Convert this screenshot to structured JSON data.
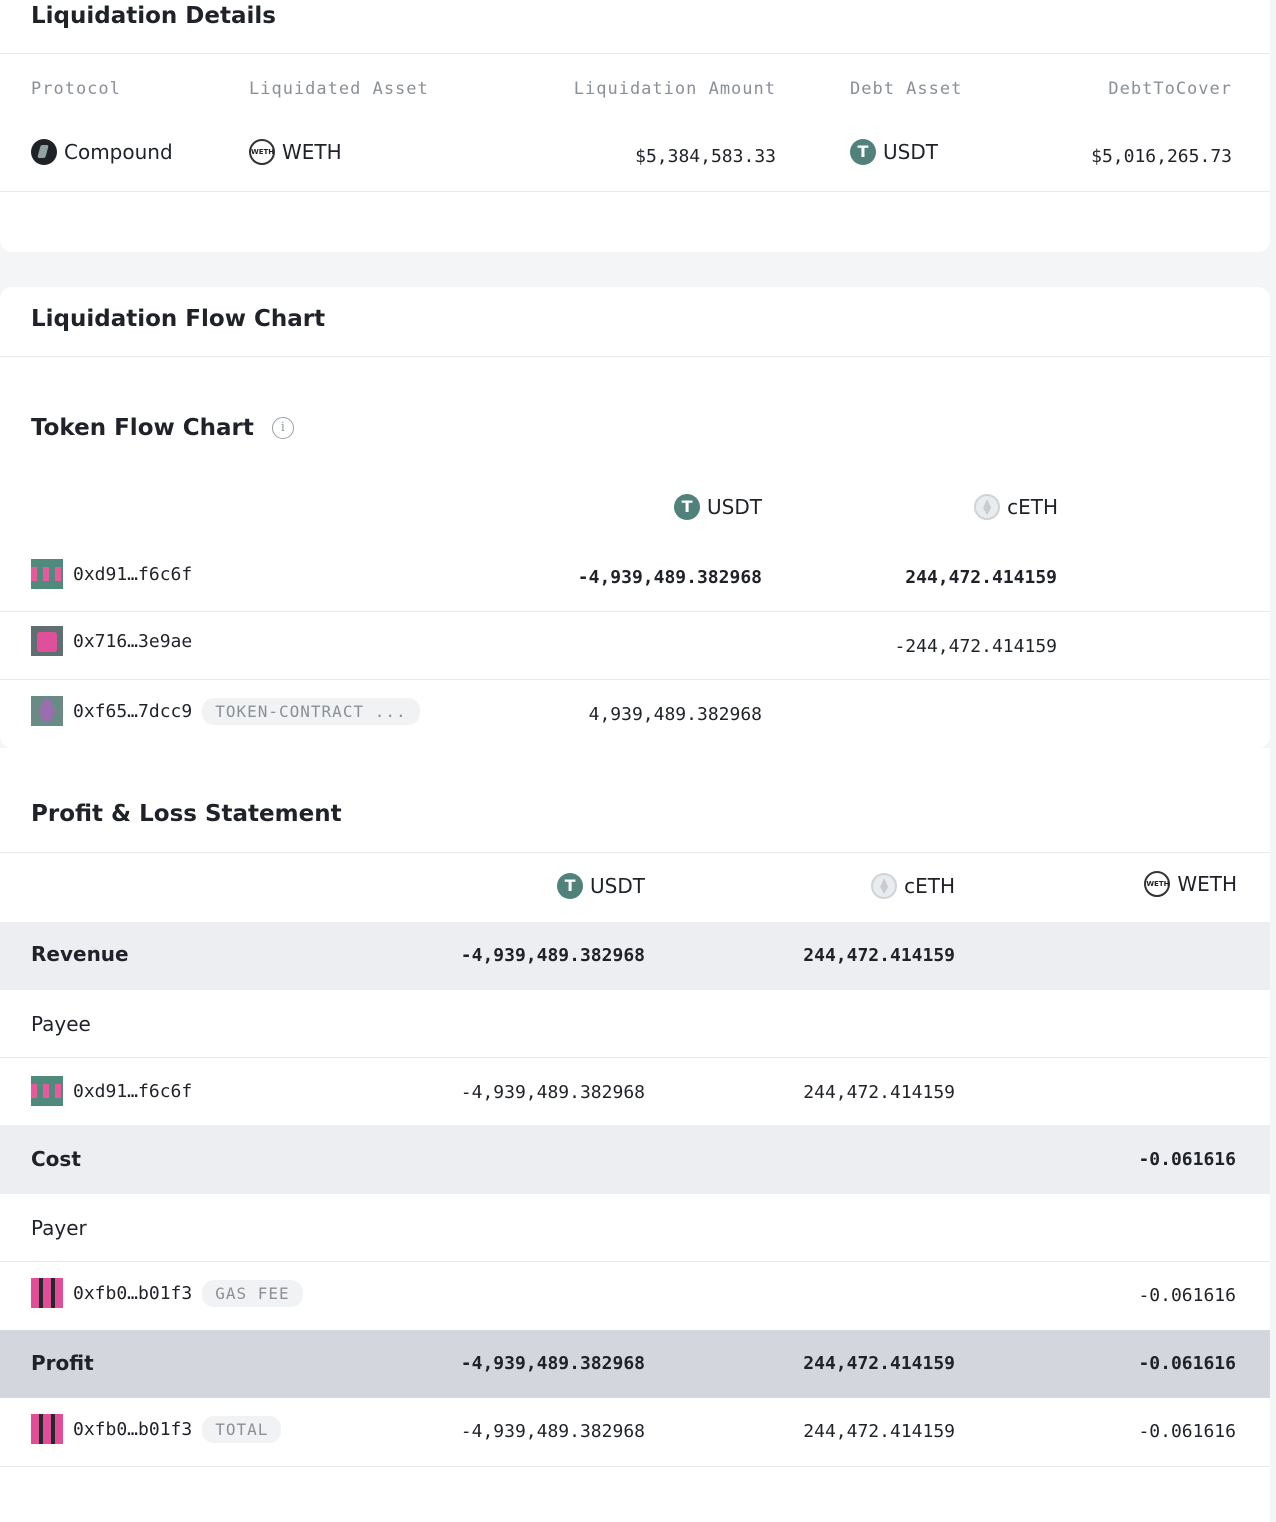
{
  "liquidation_details": {
    "title": "Liquidation Details",
    "headers": {
      "protocol": "Protocol",
      "liquidated_asset": "Liquidated Asset",
      "liquidation_amount": "Liquidation Amount",
      "debt_asset": "Debt Asset",
      "debt_to_cover": "DebtToCover"
    },
    "row": {
      "protocol": "Compound",
      "liquidated_asset": "WETH",
      "liquidation_amount": "$5,384,583.33",
      "debt_asset": "USDT",
      "debt_to_cover": "$5,016,265.73"
    }
  },
  "flow_chart": {
    "title": "Liquidation Flow Chart",
    "token_flow": {
      "title": "Token Flow Chart",
      "info_icon": "i",
      "tokens": [
        "USDT",
        "cETH"
      ],
      "rows": [
        {
          "address": "0xd91…f6c6f",
          "badge": "",
          "usdt": "-4,939,489.382968",
          "ceth": "244,472.414159"
        },
        {
          "address": "0x716…3e9ae",
          "badge": "",
          "usdt": "",
          "ceth": "-244,472.414159"
        },
        {
          "address": "0xf65…7dcc9",
          "badge": "TOKEN-CONTRACT ...",
          "usdt": "4,939,489.382968",
          "ceth": ""
        }
      ]
    }
  },
  "pnl": {
    "title": "Profit & Loss Statement",
    "tokens": [
      "USDT",
      "cETH",
      "WETH"
    ],
    "revenue": {
      "label": "Revenue",
      "usdt": "-4,939,489.382968",
      "ceth": "244,472.414159",
      "weth": ""
    },
    "payee_label": "Payee",
    "payee_row": {
      "address": "0xd91…f6c6f",
      "usdt": "-4,939,489.382968",
      "ceth": "244,472.414159",
      "weth": ""
    },
    "cost": {
      "label": "Cost",
      "usdt": "",
      "ceth": "",
      "weth": "-0.061616"
    },
    "payer_label": "Payer",
    "payer_row": {
      "address": "0xfb0…b01f3",
      "badge": "GAS FEE",
      "weth": "-0.061616"
    },
    "profit": {
      "label": "Profit",
      "usdt": "-4,939,489.382968",
      "ceth": "244,472.414159",
      "weth": "-0.061616"
    },
    "total_row": {
      "address": "0xfb0…b01f3",
      "badge": "TOTAL",
      "usdt": "-4,939,489.382968",
      "ceth": "244,472.414159",
      "weth": "-0.061616"
    }
  },
  "colors": {
    "usdt": "#50817a",
    "band": "#eceef1",
    "profit_band": "#d3d7dd",
    "muted": "#8a8f98"
  },
  "icons": [
    "compound-icon",
    "weth-icon",
    "usdt-icon",
    "ceth-icon",
    "info-icon",
    "identicon-avatar"
  ]
}
